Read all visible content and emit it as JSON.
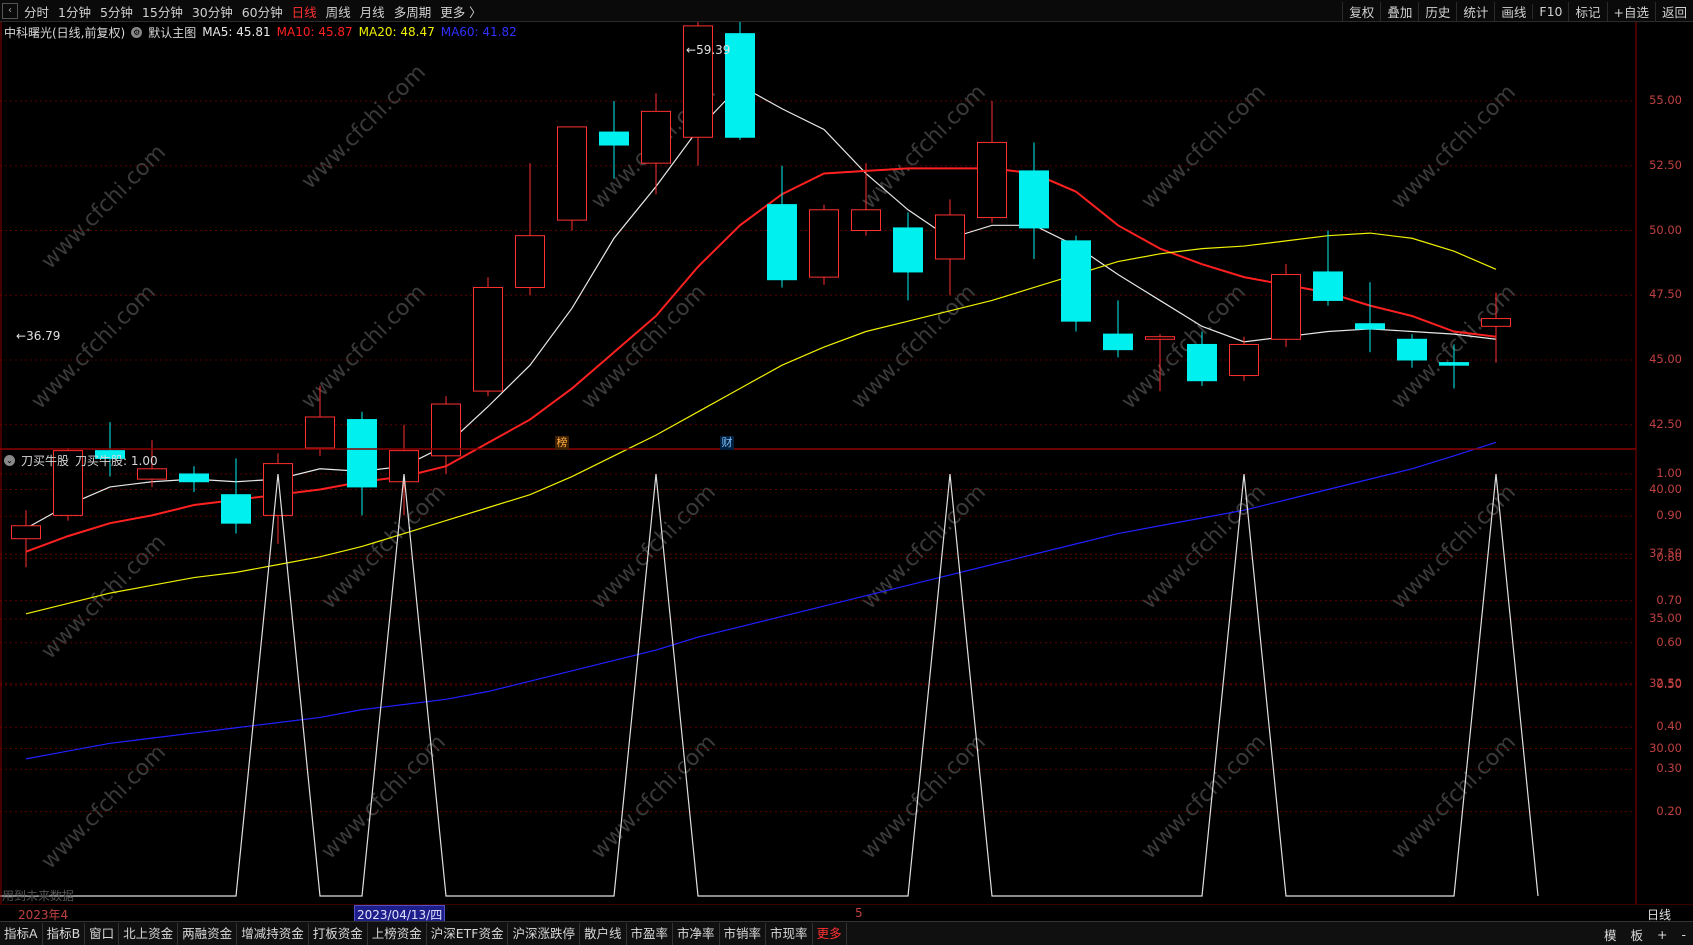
{
  "toolbar": {
    "periods": [
      "分时",
      "1分钟",
      "5分钟",
      "15分钟",
      "30分钟",
      "60分钟",
      "日线",
      "周线",
      "月线",
      "多周期",
      "更多 〉"
    ],
    "active_period": "日线",
    "tools": [
      "复权",
      "叠加",
      "历史",
      "统计",
      "画线",
      "F10",
      "标记",
      "+自选",
      "返回"
    ]
  },
  "legend": {
    "stock": "中科曙光(日线,前复权)",
    "main_chart": "默认主图",
    "ma5": "MA5: 45.81",
    "ma10": "MA10: 45.87",
    "ma20": "MA20: 48.47",
    "ma60": "MA60: 41.82",
    "colors": {
      "ma5": "#e8e8e8",
      "ma10": "#ff2020",
      "ma20": "#f0f000",
      "ma60": "#2020ff"
    }
  },
  "annotations": {
    "high": "59.39",
    "low": "36.79",
    "marker1": "榜",
    "marker2": "财",
    "future_data": "用到未来数据"
  },
  "indicator": {
    "name": "刀买牛股",
    "value": "刀买牛股: 1.00"
  },
  "price_axis": [
    "55.00",
    "52.50",
    "50.00",
    "47.50",
    "45.00",
    "42.50",
    "40.00",
    "37.50",
    "35.00",
    "32.50",
    "30.00"
  ],
  "ind_axis": [
    "1.00",
    "0.90",
    "0.80",
    "0.70",
    "0.60",
    "0.50",
    "0.40",
    "0.30",
    "0.20"
  ],
  "datebar": {
    "month_left": "2023年4",
    "cursor_date": "2023/04/13/四",
    "month5": "5",
    "period_label": "日线"
  },
  "bottom_tabs": [
    "指标A",
    "指标B",
    "窗口",
    "北上资金",
    "两融资金",
    "增减持资金",
    "打板资金",
    "上榜资金",
    "沪深ETF资金",
    "沪深涨跌停",
    "散户线",
    "市盈率",
    "市净率",
    "市销率",
    "市现率",
    "更多"
  ],
  "bottom_right": [
    "模",
    "板",
    "+",
    "-"
  ],
  "chart_data": {
    "type": "candlestick",
    "title": "中科曙光(日线,前复权)",
    "ylim": [
      28.5,
      58.5
    ],
    "candles": [
      {
        "o": 38.1,
        "c": 38.6,
        "h": 39.2,
        "l": 37.0
      },
      {
        "o": 39.0,
        "c": 41.5,
        "h": 41.6,
        "l": 38.8
      },
      {
        "o": 41.5,
        "c": 41.2,
        "h": 42.6,
        "l": 40.5
      },
      {
        "o": 40.4,
        "c": 40.8,
        "h": 41.9,
        "l": 40.1
      },
      {
        "o": 40.6,
        "c": 40.3,
        "h": 40.9,
        "l": 39.9
      },
      {
        "o": 39.8,
        "c": 38.7,
        "h": 41.2,
        "l": 38.3
      },
      {
        "o": 39.0,
        "c": 41.0,
        "h": 41.4,
        "l": 37.9
      },
      {
        "o": 41.6,
        "c": 42.8,
        "h": 44.0,
        "l": 41.3
      },
      {
        "o": 42.7,
        "c": 40.1,
        "h": 43.0,
        "l": 39.0
      },
      {
        "o": 40.3,
        "c": 41.5,
        "h": 42.5,
        "l": 39.0
      },
      {
        "o": 41.3,
        "c": 43.3,
        "h": 43.6,
        "l": 40.6
      },
      {
        "o": 43.8,
        "c": 47.8,
        "h": 48.2,
        "l": 43.6
      },
      {
        "o": 47.8,
        "c": 49.8,
        "h": 52.6,
        "l": 47.5
      },
      {
        "o": 50.4,
        "c": 54.0,
        "h": 54.0,
        "l": 50.0
      },
      {
        "o": 53.8,
        "c": 53.3,
        "h": 55.0,
        "l": 52.0
      },
      {
        "o": 52.6,
        "c": 54.6,
        "h": 55.3,
        "l": 51.4
      },
      {
        "o": 53.6,
        "c": 57.9,
        "h": 59.39,
        "l": 52.5
      },
      {
        "o": 57.6,
        "c": 53.6,
        "h": 58.2,
        "l": 53.5
      },
      {
        "o": 51.0,
        "c": 48.1,
        "h": 52.5,
        "l": 47.8
      },
      {
        "o": 48.2,
        "c": 50.8,
        "h": 51.0,
        "l": 47.9
      },
      {
        "o": 50.0,
        "c": 50.8,
        "h": 52.6,
        "l": 49.8
      },
      {
        "o": 50.1,
        "c": 48.4,
        "h": 50.7,
        "l": 47.3
      },
      {
        "o": 48.9,
        "c": 50.6,
        "h": 51.2,
        "l": 47.5
      },
      {
        "o": 50.5,
        "c": 53.4,
        "h": 55.0,
        "l": 50.3
      },
      {
        "o": 52.3,
        "c": 50.1,
        "h": 53.4,
        "l": 48.9
      },
      {
        "o": 49.6,
        "c": 46.5,
        "h": 49.8,
        "l": 46.1
      },
      {
        "o": 46.0,
        "c": 45.4,
        "h": 47.3,
        "l": 45.1
      },
      {
        "o": 45.8,
        "c": 45.9,
        "h": 46.0,
        "l": 43.8
      },
      {
        "o": 45.6,
        "c": 44.2,
        "h": 46.1,
        "l": 44.0
      },
      {
        "o": 44.4,
        "c": 45.6,
        "h": 45.9,
        "l": 44.2
      },
      {
        "o": 45.8,
        "c": 48.3,
        "h": 48.7,
        "l": 45.5
      },
      {
        "o": 48.4,
        "c": 47.3,
        "h": 50.0,
        "l": 47.1
      },
      {
        "o": 46.4,
        "c": 46.2,
        "h": 48.0,
        "l": 45.3
      },
      {
        "o": 45.8,
        "c": 45.0,
        "h": 46.0,
        "l": 44.7
      },
      {
        "o": 44.9,
        "c": 44.8,
        "h": 45.6,
        "l": 43.9
      },
      {
        "o": 46.3,
        "c": 46.6,
        "h": 47.6,
        "l": 44.9
      }
    ],
    "series": [
      {
        "name": "MA5",
        "color": "#e8e8e8",
        "values": [
          38.5,
          39.4,
          40.1,
          40.3,
          40.4,
          40.3,
          40.4,
          40.8,
          40.7,
          40.9,
          41.7,
          43.2,
          44.8,
          47.0,
          49.7,
          51.7,
          53.9,
          55.6,
          54.7,
          53.9,
          52.2,
          50.8,
          49.7,
          50.2,
          50.2,
          49.4,
          48.3,
          47.3,
          46.3,
          45.7,
          45.9,
          46.1,
          46.2,
          46.1,
          46.0,
          45.8
        ]
      },
      {
        "name": "MA10",
        "color": "#ff2020",
        "values": [
          37.6,
          38.2,
          38.7,
          39.0,
          39.4,
          39.6,
          39.8,
          40.0,
          40.3,
          40.5,
          40.9,
          41.8,
          42.7,
          43.9,
          45.3,
          46.7,
          48.6,
          50.2,
          51.4,
          52.2,
          52.3,
          52.4,
          52.4,
          52.4,
          52.2,
          51.5,
          50.2,
          49.3,
          48.7,
          48.2,
          47.9,
          47.6,
          47.1,
          46.7,
          46.1,
          45.9
        ]
      },
      {
        "name": "MA20",
        "color": "#f0f000",
        "values": [
          35.2,
          35.6,
          36.0,
          36.3,
          36.6,
          36.8,
          37.1,
          37.4,
          37.8,
          38.3,
          38.8,
          39.3,
          39.8,
          40.5,
          41.3,
          42.1,
          43.0,
          43.9,
          44.8,
          45.5,
          46.1,
          46.5,
          46.9,
          47.3,
          47.8,
          48.3,
          48.8,
          49.1,
          49.3,
          49.4,
          49.6,
          49.8,
          49.9,
          49.7,
          49.2,
          48.5
        ]
      },
      {
        "name": "MA60",
        "color": "#2020ff",
        "values": [
          29.6,
          29.9,
          30.2,
          30.4,
          30.6,
          30.8,
          31.0,
          31.2,
          31.5,
          31.7,
          31.9,
          32.2,
          32.6,
          33.0,
          33.4,
          33.8,
          34.3,
          34.7,
          35.1,
          35.5,
          35.9,
          36.3,
          36.7,
          37.1,
          37.5,
          37.9,
          38.3,
          38.6,
          38.9,
          39.2,
          39.6,
          40.0,
          40.4,
          40.8,
          41.3,
          41.82
        ]
      }
    ],
    "indicator_values": [
      0,
      0,
      0,
      0,
      0,
      0,
      1,
      0,
      0,
      1,
      0,
      0,
      0,
      0,
      0,
      1,
      0,
      0,
      0,
      0,
      0,
      0,
      1,
      0,
      0,
      0,
      0,
      0,
      0,
      1,
      0,
      0,
      0,
      0,
      0,
      1
    ]
  }
}
